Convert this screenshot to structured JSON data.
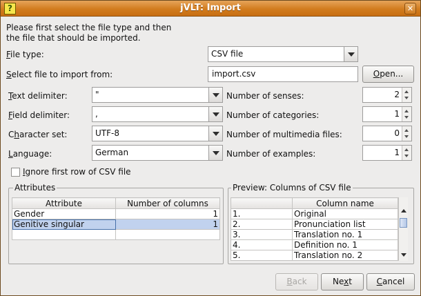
{
  "window": {
    "title": "jVLT: Import",
    "app_icon": "?",
    "close": "✕"
  },
  "intro": {
    "line1": "Please first select the file type and then",
    "line2": "the file that should be imported."
  },
  "file_type": {
    "label_mnemonic": "F",
    "label_rest": "ile type:",
    "value": "CSV file"
  },
  "select_file": {
    "label_mnemonic": "S",
    "label_rest": "elect file to import from:",
    "value": "import.csv",
    "open_mnemonic": "O",
    "open_rest": "pen..."
  },
  "text_delimiter": {
    "label_mnemonic": "T",
    "label_rest": "ext delimiter:",
    "value": "\""
  },
  "field_delimiter": {
    "label_mnemonic": "F",
    "label_rest": "ield delimiter:",
    "value": ","
  },
  "character_set": {
    "label_pre": "C",
    "label_mnemonic": "h",
    "label_rest": "aracter set:",
    "value": "UTF-8"
  },
  "language": {
    "label_mnemonic": "L",
    "label_rest": "anguage:",
    "value": "German"
  },
  "spinners": {
    "senses": {
      "label": "Number of senses:",
      "value": "2"
    },
    "categories": {
      "label": "Number of categories:",
      "value": "1"
    },
    "multimedia": {
      "label": "Number of multimedia files:",
      "value": "0"
    },
    "examples": {
      "label": "Number of examples:",
      "value": "1"
    }
  },
  "ignore_first_row": {
    "label_mnemonic": "I",
    "label_rest": "gnore first row of CSV file",
    "checked": false
  },
  "attributes": {
    "title": "Attributes",
    "headers": [
      "Attribute",
      "Number of columns"
    ],
    "rows": [
      {
        "attribute": "Gender",
        "columns": "1"
      },
      {
        "attribute": "Genitive singular",
        "columns": "1"
      }
    ]
  },
  "preview": {
    "title": "Preview: Columns of CSV file",
    "headers": [
      "",
      "Column name"
    ],
    "rows": [
      {
        "num": "1.",
        "name": "Original"
      },
      {
        "num": "2.",
        "name": "Pronunciation list"
      },
      {
        "num": "3.",
        "name": "Translation no. 1"
      },
      {
        "num": "4.",
        "name": "Definition no. 1"
      },
      {
        "num": "5.",
        "name": "Translation no. 2"
      }
    ]
  },
  "buttons": {
    "back_mnemonic": "B",
    "back_rest": "ack",
    "next_pre": "Ne",
    "next_mnemonic": "x",
    "next_rest": "t",
    "cancel_mnemonic": "C",
    "cancel_rest": "ancel"
  },
  "colors": {
    "titlebar": "#d27c1e",
    "selection": "#c1d2ee",
    "dialog_bg": "#edeceb"
  }
}
